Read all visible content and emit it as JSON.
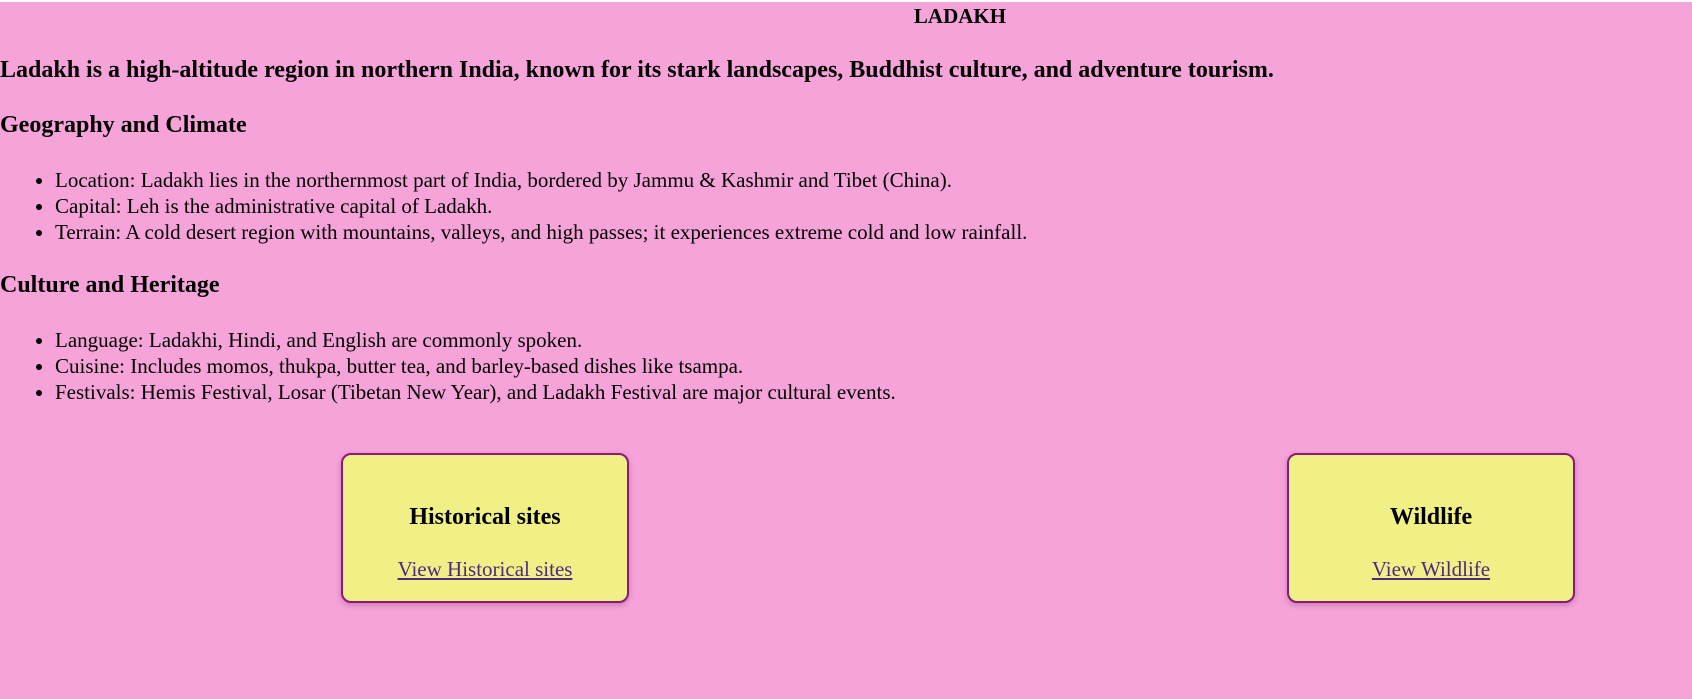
{
  "page": {
    "title": "LADAKH",
    "tagline": "Ladakh is a high-altitude region in northern India, known for its stark landscapes, Buddhist culture, and adventure tourism."
  },
  "sections": [
    {
      "heading": "Geography and Climate",
      "items": [
        "Location: Ladakh lies in the northernmost part of India, bordered by Jammu & Kashmir and Tibet (China).",
        "Capital: Leh is the administrative capital of Ladakh.",
        "Terrain: A cold desert region with mountains, valleys, and high passes; it experiences extreme cold and low rainfall."
      ]
    },
    {
      "heading": "Culture and Heritage",
      "items": [
        "Language: Ladakhi, Hindi, and English are commonly spoken.",
        "Cuisine: Includes momos, thukpa, butter tea, and barley-based dishes like tsampa.",
        "Festivals: Hemis Festival, Losar (Tibetan New Year), and Ladakh Festival are major cultural events."
      ]
    }
  ],
  "cards": [
    {
      "title": "Historical sites",
      "link_label": "View Historical sites"
    },
    {
      "title": "Wildlife",
      "link_label": "View Wildlife"
    }
  ],
  "colors": {
    "page_background": "#f5a3d9",
    "card_background": "#f0f087",
    "card_border": "#8a1a78",
    "link": "#4b2a80"
  }
}
